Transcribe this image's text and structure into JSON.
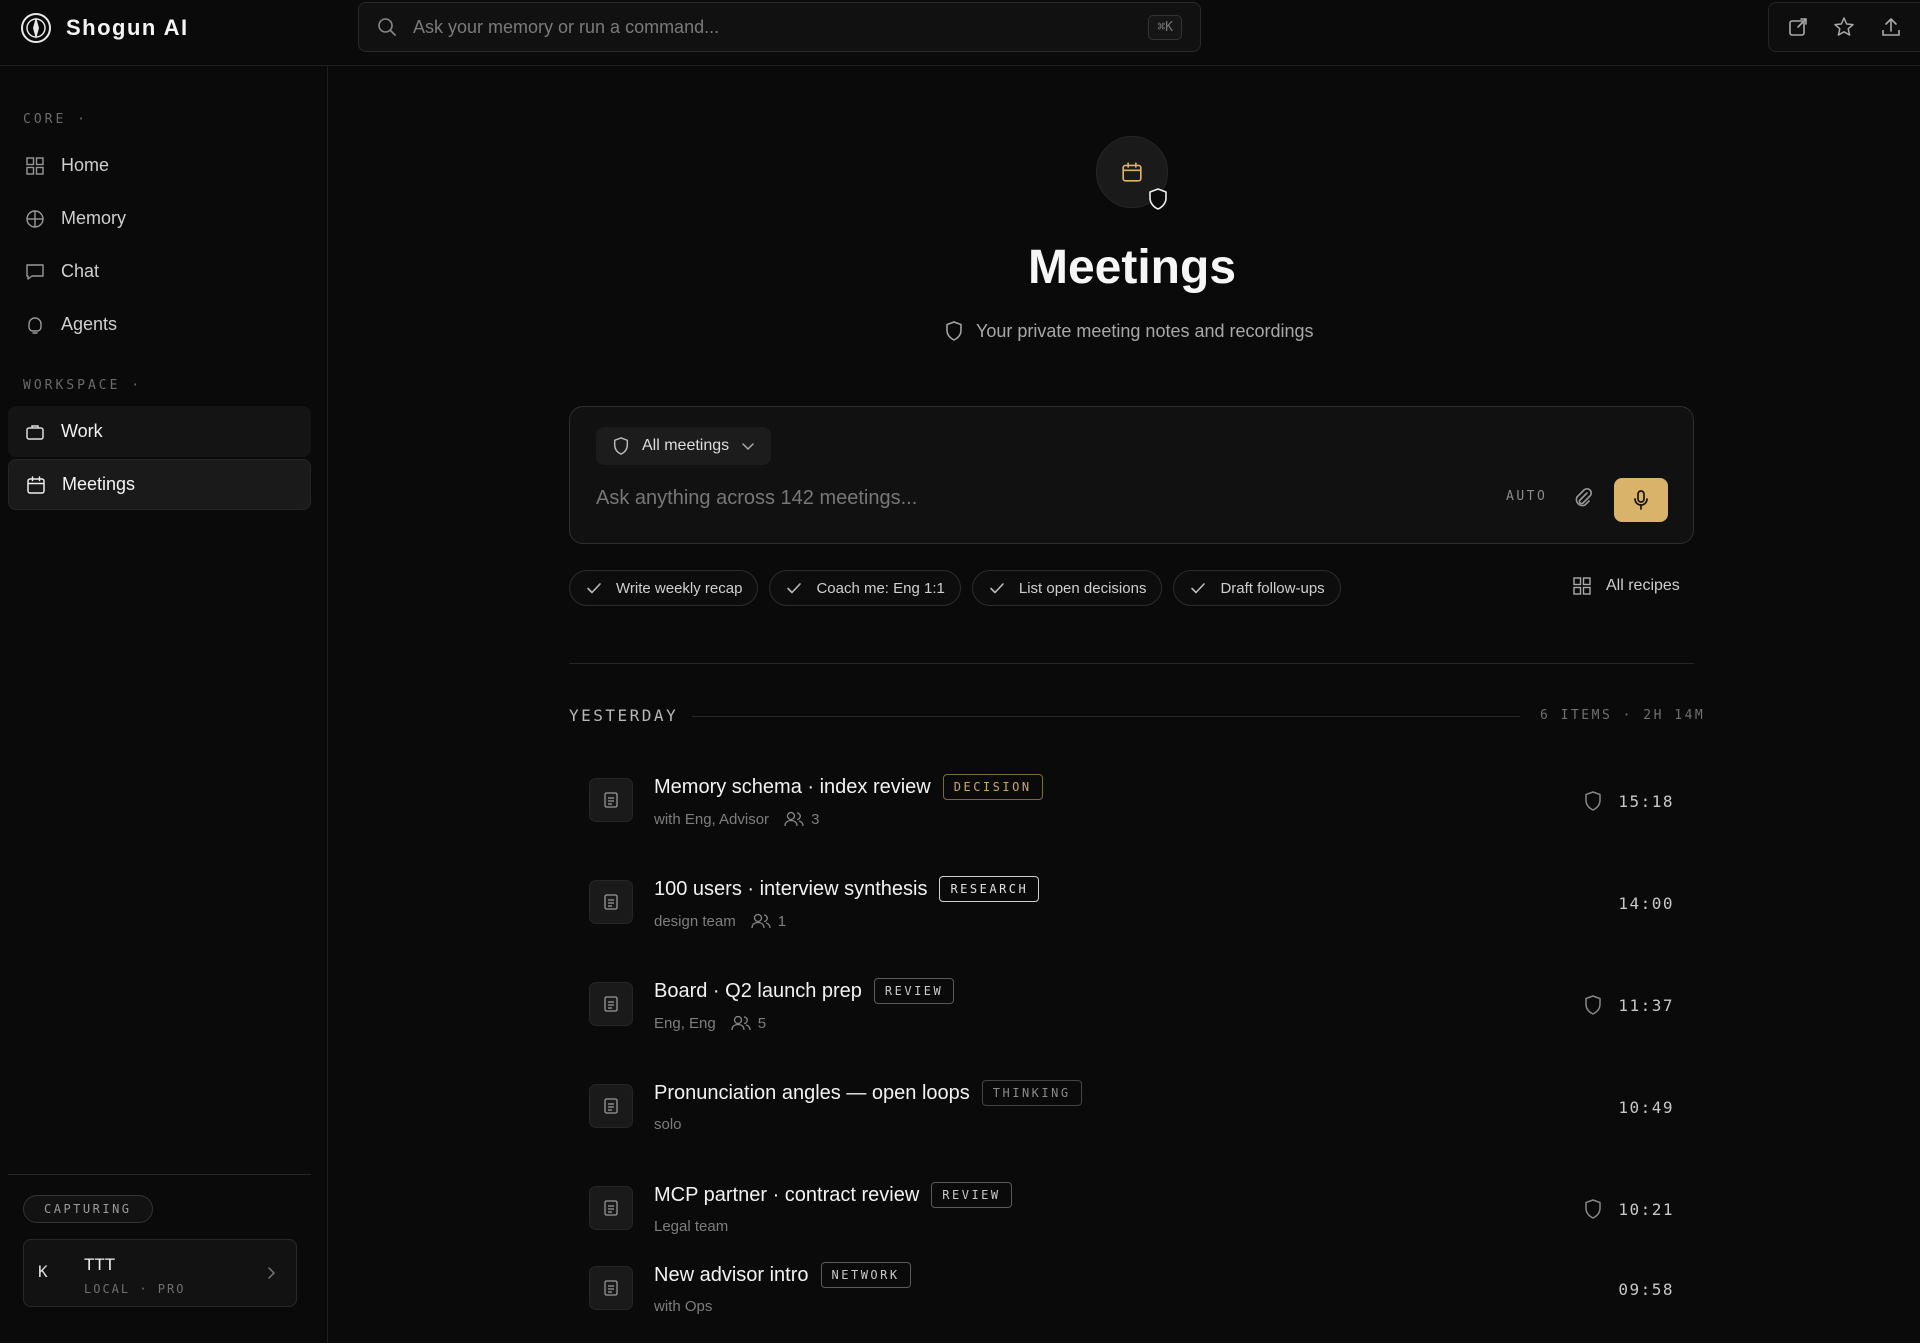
{
  "app": {
    "name": "Shogun AI"
  },
  "search": {
    "placeholder": "Ask your memory or run a command...",
    "shortcut": "⌘K"
  },
  "sidebar": {
    "core_label": "CORE ·",
    "core_items": [
      {
        "label": "Home",
        "icon": "grid-icon"
      },
      {
        "label": "Memory",
        "icon": "globe-icon"
      },
      {
        "label": "Chat",
        "icon": "chat-icon"
      },
      {
        "label": "Agents",
        "icon": "agent-icon"
      }
    ],
    "workspace_label": "WORKSPACE ·",
    "workspace_items": [
      {
        "label": "Work",
        "icon": "briefcase-icon"
      },
      {
        "label": "Meetings",
        "icon": "calendar-icon",
        "active": true
      }
    ],
    "capturing": "CAPTURING",
    "user": {
      "avatar": "K",
      "name": "TTT",
      "plan": "LOCAL · PRO"
    }
  },
  "page": {
    "title": "Meetings",
    "subtitle": "Your private meeting notes and recordings"
  },
  "composer": {
    "scope_label": "All meetings",
    "placeholder": "Ask anything across 142 meetings...",
    "auto_label": "AUTO"
  },
  "recipes": {
    "chips": [
      "Write weekly recap",
      "Coach me: Eng 1:1",
      "List open decisions",
      "Draft follow-ups"
    ],
    "all_label": "All recipes"
  },
  "group": {
    "label": "YESTERDAY",
    "meta": "6 ITEMS · 2H 14M",
    "meetings": [
      {
        "title": "Memory schema · index review",
        "tag": "DECISION",
        "meta": "with Eng, Advisor",
        "people": "3",
        "private": true,
        "time": "15:18"
      },
      {
        "title": "100 users · interview synthesis",
        "tag": "RESEARCH",
        "meta": "design team",
        "people": "1",
        "private": false,
        "time": "14:00"
      },
      {
        "title": "Board · Q2 launch prep",
        "tag": "REVIEW",
        "meta": "Eng, Eng",
        "people": "5",
        "private": true,
        "time": "11:37"
      },
      {
        "title": "Pronunciation angles — open loops",
        "tag": "THINKING",
        "meta": "solo",
        "people": "",
        "private": false,
        "time": "10:49"
      },
      {
        "title": "MCP partner · contract review",
        "tag": "REVIEW",
        "meta": "Legal team",
        "people": "",
        "private": true,
        "time": "10:21"
      },
      {
        "title": "New advisor intro",
        "tag": "NETWORK",
        "meta": "with Ops",
        "people": "",
        "private": false,
        "time": "09:58"
      }
    ]
  },
  "colors": {
    "accent": "#d9b36a",
    "background": "#0a0a0a",
    "surface": "#111111"
  }
}
